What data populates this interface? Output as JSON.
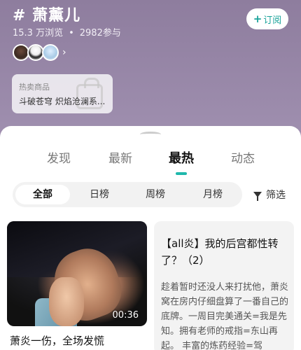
{
  "topic": {
    "title": "# 萧薰儿",
    "views": "15.3 万浏览",
    "separator": "•",
    "participants": "2982参与",
    "subscribe_plus": "+",
    "subscribe_label": "订阅"
  },
  "avatars": {
    "chevron": "›"
  },
  "hot_goods": {
    "label": "热卖商品",
    "items": "斗破苍穹 炽焰沧澜系..."
  },
  "tabs": [
    {
      "label": "发现"
    },
    {
      "label": "最新"
    },
    {
      "label": "最热"
    },
    {
      "label": "动态"
    }
  ],
  "active_tab": "最热",
  "filters": [
    {
      "label": "全部"
    },
    {
      "label": "日榜"
    },
    {
      "label": "周榜"
    },
    {
      "label": "月榜"
    }
  ],
  "filter_button": "筛选",
  "colors": {
    "accent": "#1fb8ac",
    "header_bg": "#a292b2"
  },
  "feed": {
    "video_card": {
      "duration": "00:36",
      "title": "萧炎一伤，全场发慌"
    },
    "text_card": {
      "title": "【all炎】我的后宫都性转了？（2）",
      "body": "趁着暂时还没人来打扰他，萧炎窝在房内仔细盘算了一番自己的底牌。一周目完美通关=我是先知。拥有老师的戒指=东山再起。 丰富的炼药经验=驾"
    }
  }
}
